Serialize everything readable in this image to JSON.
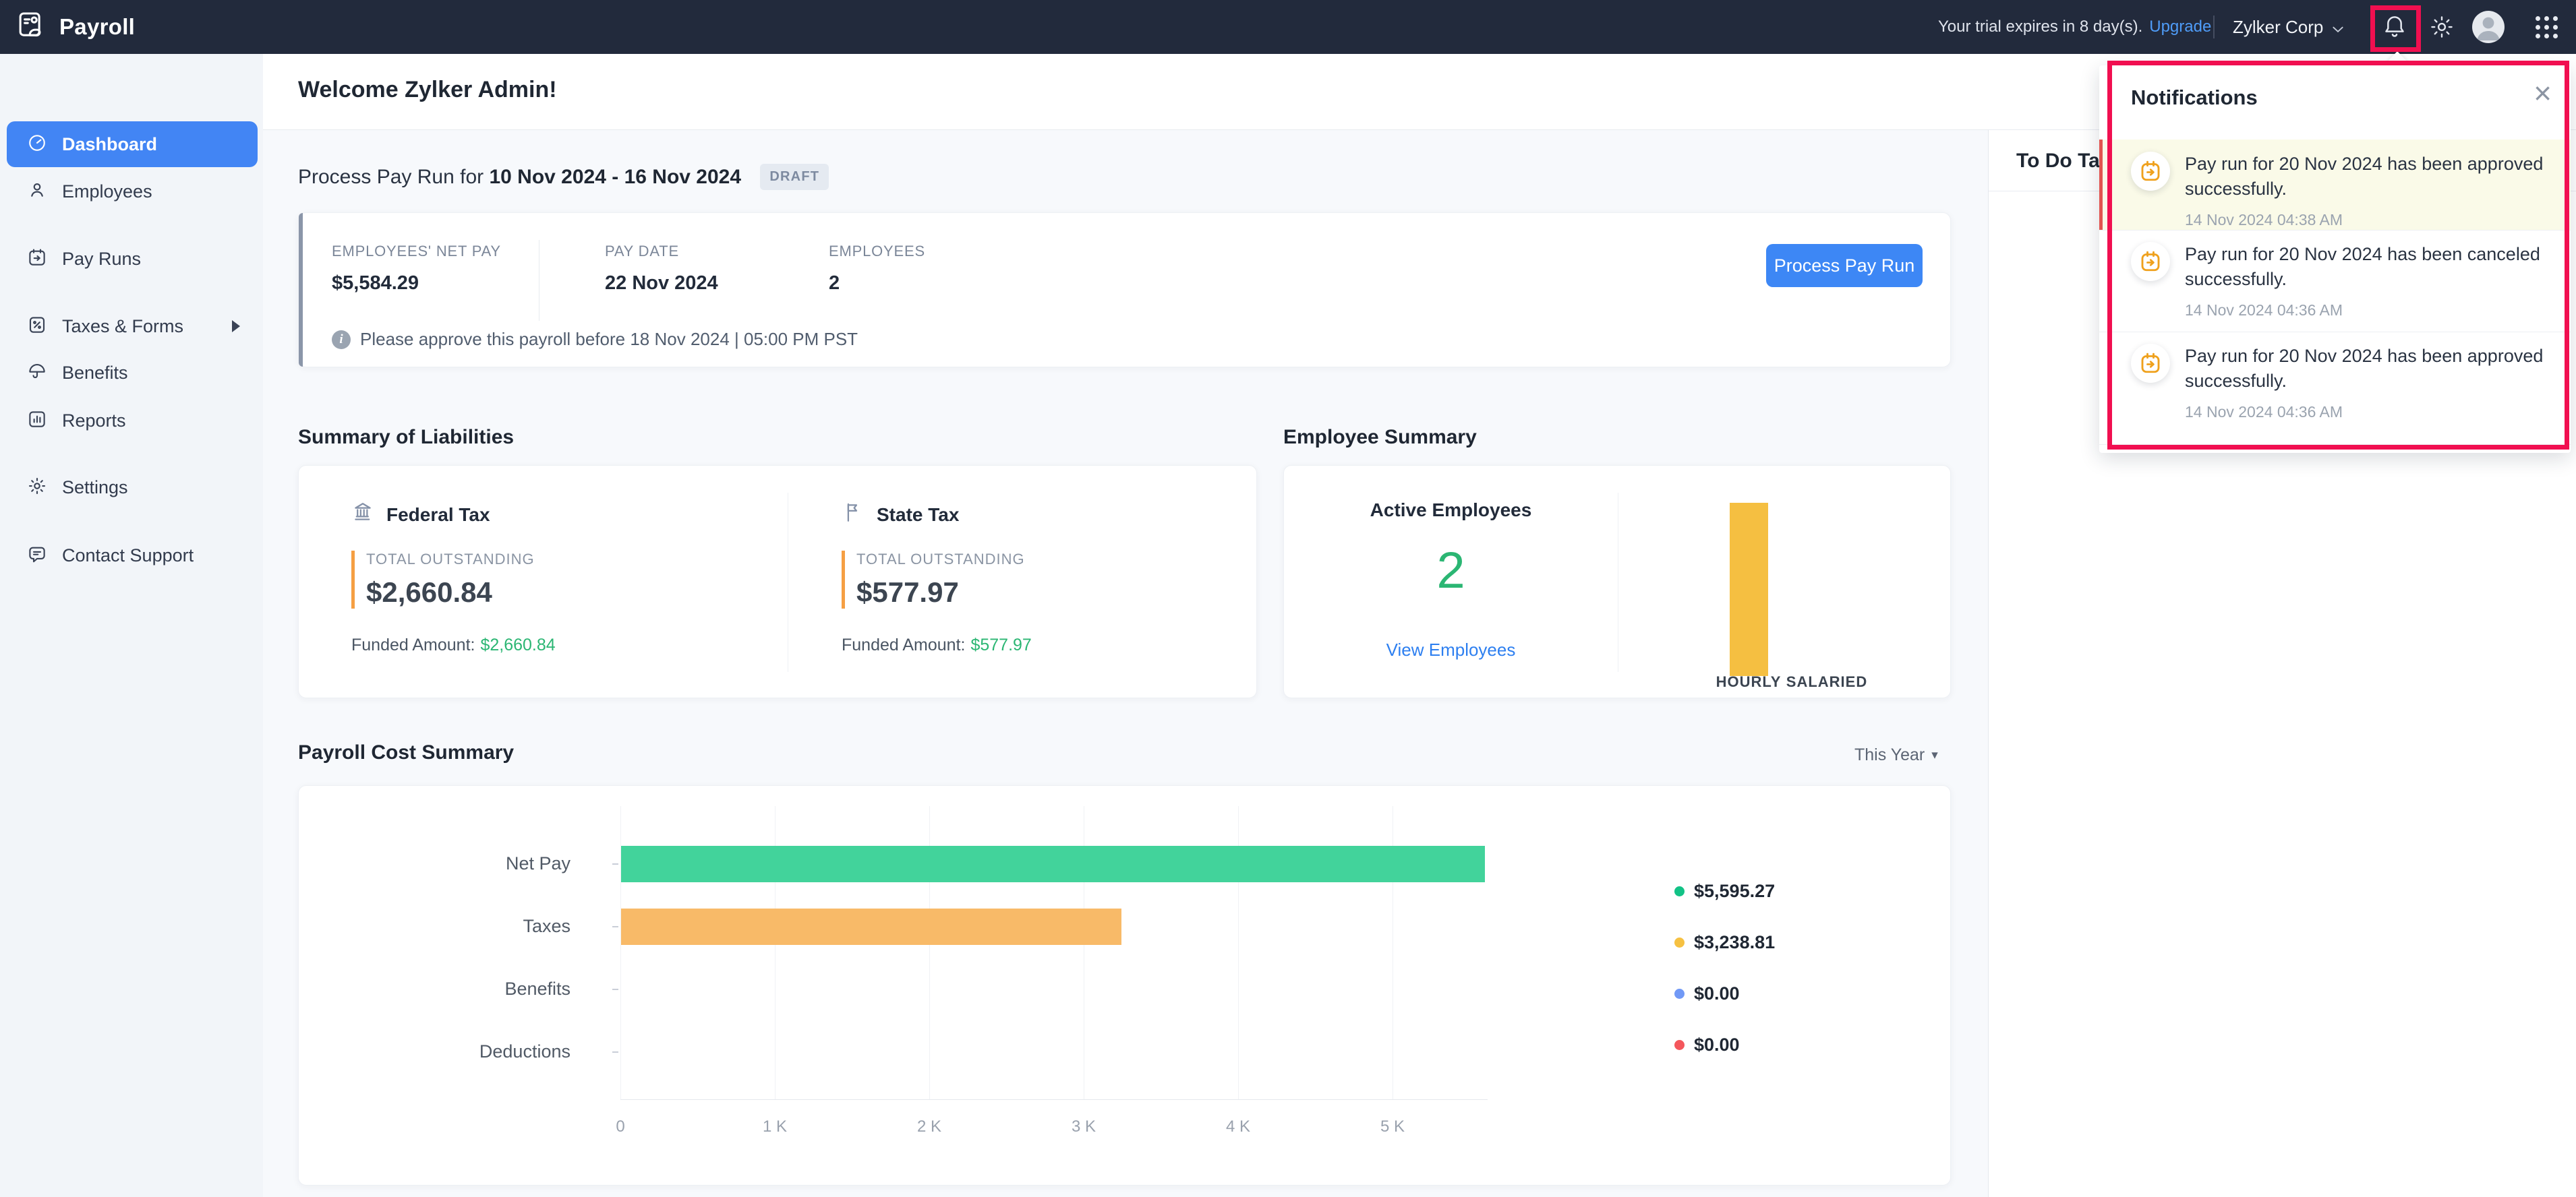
{
  "topbar": {
    "app_name": "Payroll",
    "trial_text": "Your trial expires in 8 day(s).",
    "upgrade_label": "Upgrade",
    "org_name": "Zylker Corp"
  },
  "sidebar": {
    "items": [
      {
        "key": "dashboard",
        "label": "Dashboard",
        "active": true
      },
      {
        "key": "employees",
        "label": "Employees"
      },
      {
        "key": "pay-runs",
        "label": "Pay Runs"
      },
      {
        "key": "taxes-forms",
        "label": "Taxes & Forms",
        "has_submenu": true
      },
      {
        "key": "benefits",
        "label": "Benefits"
      },
      {
        "key": "reports",
        "label": "Reports"
      },
      {
        "key": "settings",
        "label": "Settings"
      },
      {
        "key": "contact-support",
        "label": "Contact Support"
      }
    ]
  },
  "main": {
    "welcome_title": "Welcome Zylker Admin!",
    "payrun": {
      "title_prefix": "Process Pay Run for",
      "period": "10 Nov 2024 - 16 Nov 2024",
      "status_badge": "DRAFT",
      "columns": [
        {
          "label": "EMPLOYEES' NET PAY",
          "value": "$5,584.29"
        },
        {
          "label": "PAY DATE",
          "value": "22 Nov 2024"
        },
        {
          "label": "EMPLOYEES",
          "value": "2"
        }
      ],
      "approve_note": "Please approve this payroll before 18 Nov 2024 | 05:00 PM PST",
      "process_button": "Process Pay Run"
    },
    "liabilities": {
      "title": "Summary of Liabilities",
      "items": [
        {
          "name": "Federal Tax",
          "icon": "capitol",
          "outstanding_label": "TOTAL OUTSTANDING",
          "outstanding": "$2,660.84",
          "funded_label": "Funded Amount:",
          "funded": "$2,660.84"
        },
        {
          "name": "State Tax",
          "icon": "flag",
          "outstanding_label": "TOTAL OUTSTANDING",
          "outstanding": "$577.97",
          "funded_label": "Funded Amount:",
          "funded": "$577.97"
        }
      ]
    },
    "employee_summary": {
      "title": "Employee Summary",
      "active_label": "Active Employees",
      "active_count": "2",
      "view_link": "View Employees"
    },
    "cost_summary": {
      "title": "Payroll Cost Summary",
      "range_label": "This Year"
    }
  },
  "todo": {
    "visible_title": "To Do Ta"
  },
  "notifications": {
    "title": "Notifications",
    "close_icon": "×",
    "items": [
      {
        "message": "Pay run for 20 Nov 2024 has been approved successfully.",
        "time": "14 Nov 2024 04:38 AM",
        "unread": true
      },
      {
        "message": "Pay run for 20 Nov 2024 has been canceled successfully.",
        "time": "14 Nov 2024 04:36 AM",
        "unread": false
      },
      {
        "message": "Pay run for 20 Nov 2024 has been approved successfully.",
        "time": "14 Nov 2024 04:36 AM",
        "unread": false
      }
    ]
  },
  "chart_data": [
    {
      "id": "payroll-cost-summary",
      "type": "bar",
      "orientation": "horizontal",
      "title": "Payroll Cost Summary",
      "range_label": "This Year",
      "categories": [
        "Net Pay",
        "Taxes",
        "Benefits",
        "Deductions"
      ],
      "values": [
        5595.27,
        3238.81,
        0,
        0
      ],
      "value_labels": [
        "$5,595.27",
        "$3,238.81",
        "$0.00",
        "$0.00"
      ],
      "bar_colors": [
        "#42d39b",
        "#f8ba68",
        "#7199f6",
        "#f4575c"
      ],
      "legend_dot_colors": [
        "#12c286",
        "#f6c142",
        "#7199f6",
        "#f4575c"
      ],
      "x_ticks": [
        "0",
        "1 K",
        "2 K",
        "3 K",
        "4 K",
        "5 K"
      ],
      "x_tick_values": [
        0,
        1000,
        2000,
        3000,
        4000,
        5000
      ],
      "xlim": [
        0,
        5600
      ],
      "grid": true,
      "legend_position": "right"
    },
    {
      "id": "employee-summary-chart",
      "type": "bar",
      "orientation": "vertical",
      "title": "Employee Summary",
      "categories": [
        "HOURLY",
        "SALARIED"
      ],
      "values": [
        2,
        0
      ],
      "bar_colors": [
        "#f5bf41",
        "#f5bf41"
      ]
    }
  ],
  "colors": {
    "annotation_pink": "#f10f50",
    "primary_blue": "#3d87f5",
    "active_nav_blue": "#4285f4",
    "topbar_bg": "#222a3c",
    "green": "#2bb673",
    "link_blue": "#2d7ff0",
    "orange_accent": "#f59f43",
    "unread_bg": "#fafae8",
    "unread_accent": "#e25450",
    "notification_icon_yellow": "#efa11d"
  }
}
